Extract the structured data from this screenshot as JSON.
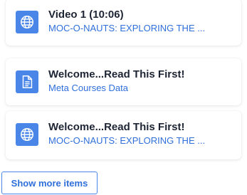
{
  "colors": {
    "icon_background": "#4a86e8",
    "title_text": "#1d2433",
    "link_text": "#2f6fdb",
    "button_border": "#4a86e8"
  },
  "items": [
    {
      "icon": "globe-icon",
      "title": "Video 1 (10:06)",
      "subtitle": "MOC-O-NAUTS: EXPLORING THE ..."
    },
    {
      "icon": "document-icon",
      "title": "Welcome...Read This First!",
      "subtitle": "Meta Courses Data"
    },
    {
      "icon": "globe-icon",
      "title": "Welcome...Read This First!",
      "subtitle": "MOC-O-NAUTS: EXPLORING THE ..."
    }
  ],
  "show_more_label": "Show more items"
}
